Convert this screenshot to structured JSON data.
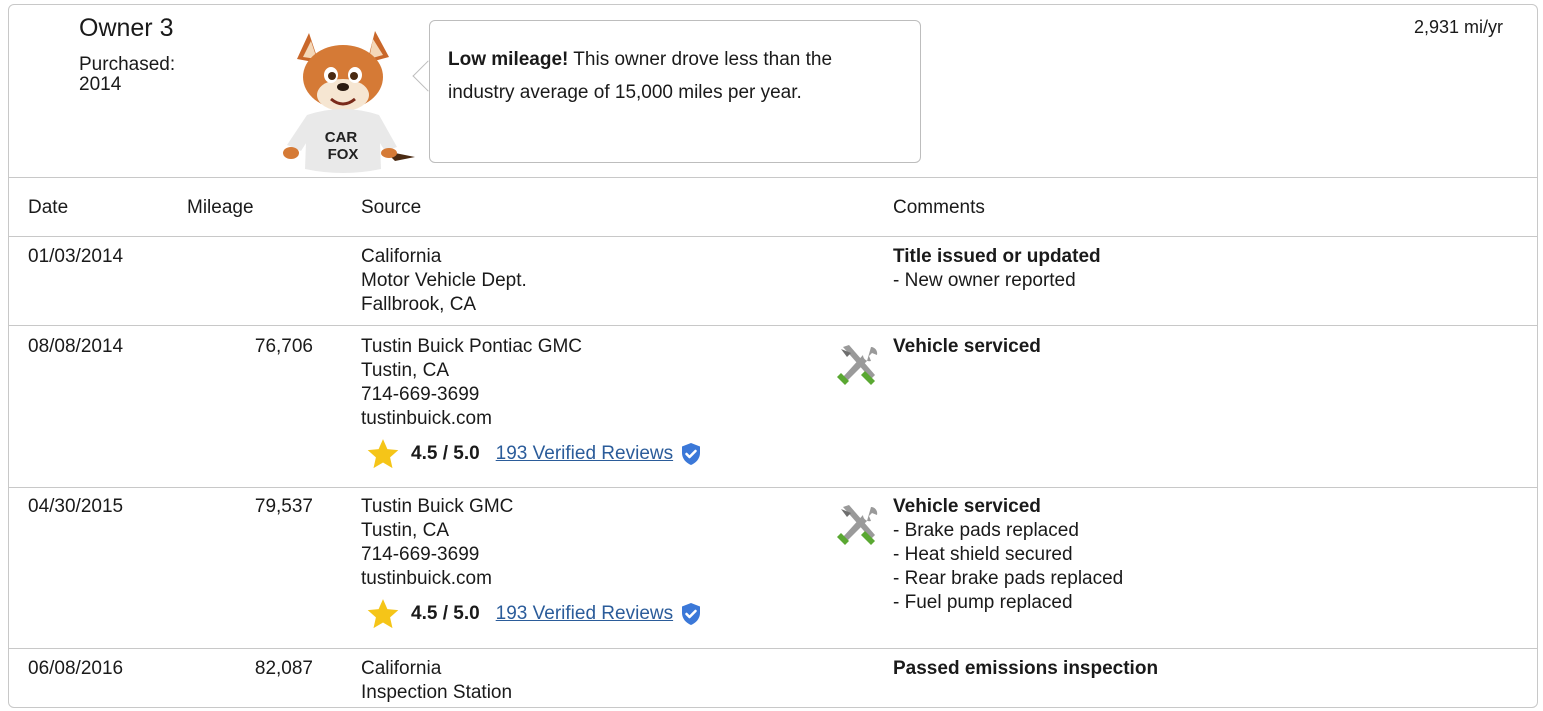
{
  "owner": {
    "title": "Owner 3",
    "purchased_label": "Purchased:",
    "purchased_year": "2014",
    "miles_per_year": "2,931 mi/yr"
  },
  "bubble": {
    "lead": "Low mileage!",
    "text": " This owner drove less than the industry average of 15,000 miles per year."
  },
  "fox": {
    "shirt_line1": "CAR",
    "shirt_line2": "FOX"
  },
  "table": {
    "headers": {
      "date": "Date",
      "mileage": "Mileage",
      "source": "Source",
      "comments": "Comments"
    },
    "rows": [
      {
        "date": "01/03/2014",
        "mileage": "",
        "source": [
          "California",
          "Motor Vehicle Dept.",
          "Fallbrook, CA"
        ],
        "comment_title": "Title issued or updated",
        "comment_items": [
          "- New owner reported"
        ]
      },
      {
        "date": "08/08/2014",
        "mileage": "76,706",
        "source": [
          "Tustin Buick Pontiac GMC",
          "Tustin, CA",
          "714-669-3699",
          "tustinbuick.com"
        ],
        "rating": "4.5 / 5.0",
        "reviews": "193 Verified Reviews",
        "comment_title": "Vehicle serviced",
        "comment_items": []
      },
      {
        "date": "04/30/2015",
        "mileage": "79,537",
        "source": [
          "Tustin Buick GMC",
          "Tustin, CA",
          "714-669-3699",
          "tustinbuick.com"
        ],
        "rating": "4.5 / 5.0",
        "reviews": "193 Verified Reviews",
        "comment_title": "Vehicle serviced",
        "comment_items": [
          "- Brake pads replaced",
          "- Heat shield secured",
          "- Rear brake pads replaced",
          "- Fuel pump replaced"
        ]
      },
      {
        "date": "06/08/2016",
        "mileage": "82,087",
        "source": [
          "California",
          "Inspection Station"
        ],
        "comment_title": "Passed emissions inspection",
        "comment_items": []
      }
    ]
  },
  "colors": {
    "border": "#c8c8c8",
    "link": "#2b5c9a",
    "star": "#f5c518",
    "verified": "#3b78d8",
    "tool_green": "#5aa832"
  },
  "icons": {
    "rating": "star-icon",
    "verified": "verified-shield-icon",
    "service": "tools-icon"
  }
}
